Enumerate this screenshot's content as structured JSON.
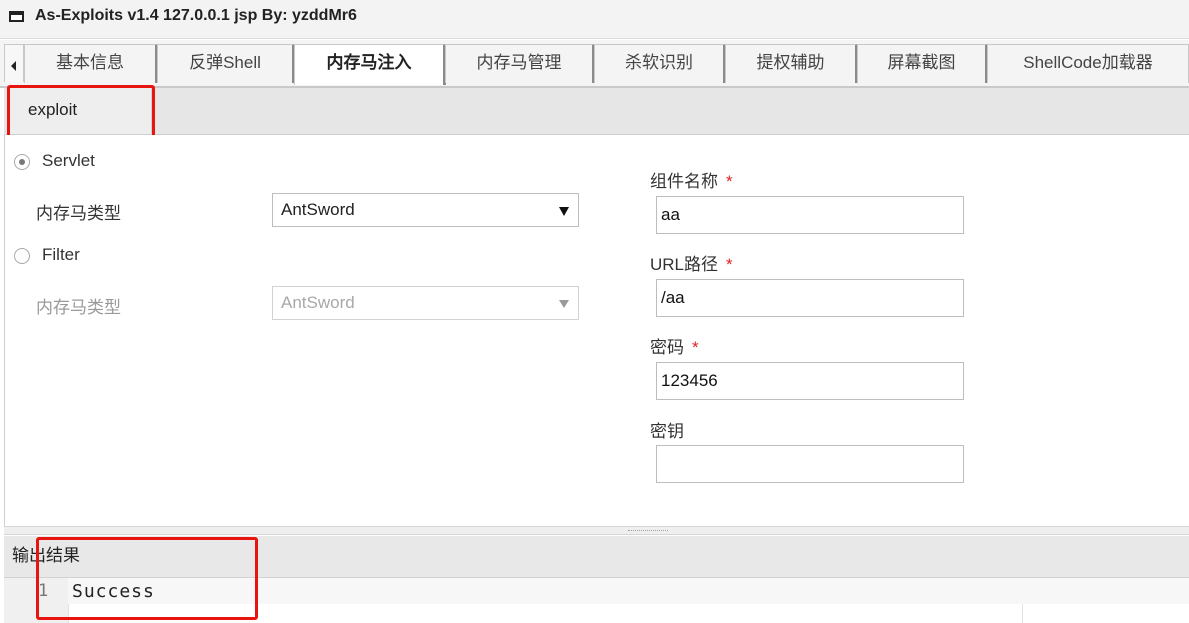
{
  "window": {
    "title": "As-Exploits v1.4 127.0.0.1 jsp By: yzddMr6",
    "icon": "window-icon"
  },
  "tabs": [
    {
      "label": "基本信息",
      "active": false
    },
    {
      "label": "反弹Shell",
      "active": false
    },
    {
      "label": "内存马注入",
      "active": true
    },
    {
      "label": "内存马管理",
      "active": false
    },
    {
      "label": "杀软识别",
      "active": false
    },
    {
      "label": "提权辅助",
      "active": false
    },
    {
      "label": "屏幕截图",
      "active": false
    },
    {
      "label": "ShellCode加载器",
      "active": false
    }
  ],
  "subtab": {
    "label": "exploit"
  },
  "servlet": {
    "radio_label": "Servlet",
    "type_label": "内存马类型",
    "type_value": "AntSword",
    "checked": true
  },
  "filter": {
    "radio_label": "Filter",
    "type_label": "内存马类型",
    "type_value": "AntSword",
    "checked": false
  },
  "fields": {
    "component_name": {
      "label": "组件名称",
      "required_mark": "*",
      "value": "aa"
    },
    "url_path": {
      "label": "URL路径",
      "required_mark": "*",
      "value": "/aa"
    },
    "password": {
      "label": "密码",
      "required_mark": "*",
      "value": "123456"
    },
    "key": {
      "label": "密钥",
      "value": ""
    }
  },
  "output": {
    "header": "输出结果",
    "lines": [
      {
        "no": "1",
        "text": "Success"
      }
    ]
  },
  "colors": {
    "highlight_box": "#e8140f",
    "required": "#e02020"
  }
}
